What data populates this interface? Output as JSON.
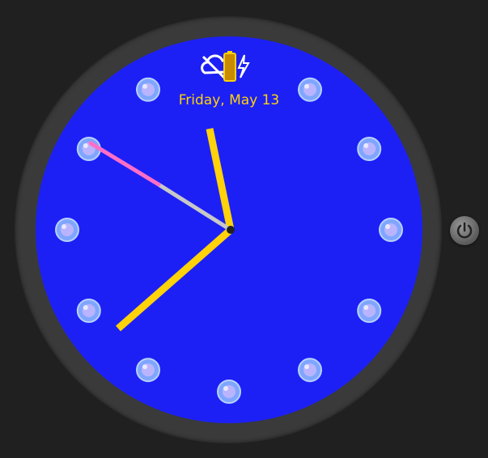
{
  "watch": {
    "date_text": "Friday, May 13",
    "colors": {
      "face": "#1c20f5",
      "bezel": "#3a3a3a",
      "hour_minute_hands": "#ffd20a",
      "second_hand": "#c8c8c8",
      "second_hand_tip": "#ff6ec7",
      "date_text": "#ffd20a",
      "hour_markers": "#8fb3ff"
    },
    "status_icons": [
      "cloud-off-icon",
      "battery-icon",
      "charging-bolt-icon"
    ],
    "hour_marker_icon": "crystal-gem-icon",
    "hour_marker_count": 12
  },
  "controls": {
    "power_button_icon": "power-icon"
  }
}
